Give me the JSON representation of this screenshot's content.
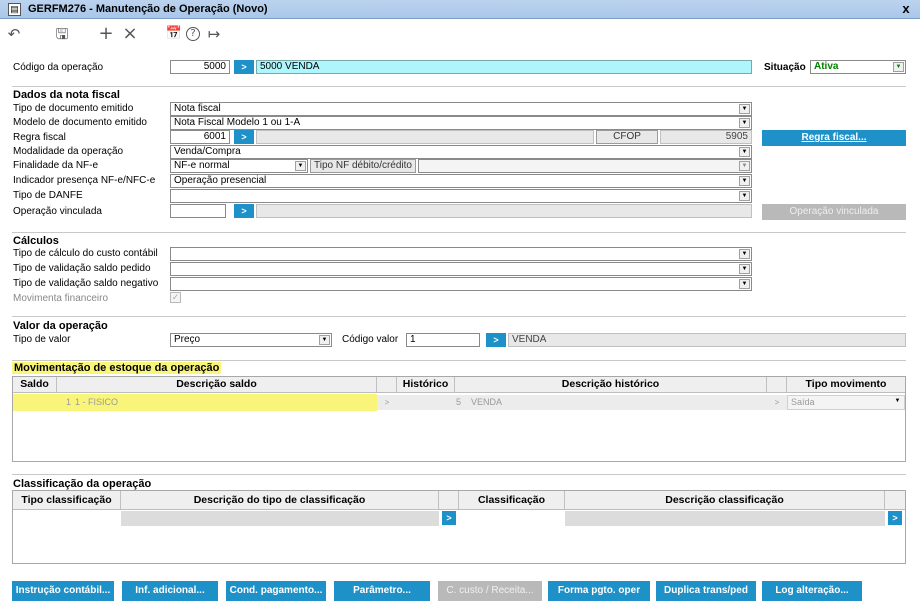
{
  "window": {
    "title": "GERFM276 - Manutenção de Operação (Novo)",
    "close_glyph": "x"
  },
  "toolbar": {
    "undo_glyph": "↶",
    "save_glyph": "🖫",
    "add_glyph": "+",
    "delete_glyph": "×",
    "calendar_glyph": "📅",
    "help_glyph": "?",
    "exit_glyph": "↦"
  },
  "header": {
    "codigo_label": "Código da operação",
    "codigo_value": "5000",
    "codigo_desc": "5000 VENDA",
    "situacao_label": "Situação",
    "situacao_value": "Ativa"
  },
  "nota_fiscal": {
    "section": "Dados da nota fiscal",
    "tipo_doc_label": "Tipo de documento emitido",
    "tipo_doc_value": "Nota fiscal",
    "modelo_label": "Modelo de documento emitido",
    "modelo_value": "Nota Fiscal Modelo 1 ou 1-A",
    "regra_label": "Regra fiscal",
    "regra_value": "6001",
    "cfop_label": "CFOP",
    "cfop_value": "5905",
    "regra_button": "Regra fiscal...",
    "modalidade_label": "Modalidade da operação",
    "modalidade_value": "Venda/Compra",
    "finalidade_label": "Finalidade da NF-e",
    "finalidade_value": "NF-e normal",
    "tipo_nf_button": "Tipo NF débito/crédito",
    "indicador_label": "Indicador presença NF-e/NFC-e",
    "indicador_value": "Operação presencial",
    "danfe_label": "Tipo de DANFE",
    "danfe_value": "",
    "vinculada_label": "Operação vinculada",
    "vinculada_value": "",
    "vinculada_button": "Operação vinculada"
  },
  "calculos": {
    "section": "Cálculos",
    "custo_label": "Tipo de cálculo do custo contábil",
    "pedido_label": "Tipo de validação saldo pedido",
    "negativo_label": "Tipo de validação saldo negativo",
    "financeiro_label": "Movimenta financeiro",
    "financeiro_checked": true
  },
  "valor": {
    "section": "Valor da operação",
    "tipo_label": "Tipo de valor",
    "tipo_value": "Preço",
    "codigo_label": "Código valor",
    "codigo_value": "1",
    "codigo_desc": "VENDA"
  },
  "estoque": {
    "section": "Movimentação de estoque da operação",
    "headers": [
      "Saldo",
      "Descrição saldo",
      "Histórico",
      "Descrição histórico",
      "Tipo movimento"
    ],
    "rows": [
      {
        "saldo": "1",
        "descricao": "1 - FISICO",
        "historico": "5",
        "desc_historico": "VENDA",
        "tipo": "Saída"
      }
    ]
  },
  "classificacao": {
    "section": "Classificação da operação",
    "headers": [
      "Tipo classificação",
      "Descrição do tipo de classificação",
      "Classificação",
      "Descrição classificação"
    ]
  },
  "buttons": {
    "instrucao": "Instrução contábil...",
    "inf": "Inf. adicional...",
    "cond": "Cond. pagamento...",
    "parametro": "Parâmetro...",
    "custo": "C. custo / Receita...",
    "forma": "Forma pgto. oper",
    "duplica": "Duplica trans/ped",
    "log": "Log alteração..."
  },
  "colors": {
    "accent": "#1d91c8",
    "highlight": "#f9f57a",
    "cyan_field": "#aef6fb",
    "status_green": "#008000"
  },
  "icons": [
    "undo-icon",
    "save-icon",
    "add-icon",
    "delete-icon",
    "calendar-icon",
    "help-icon",
    "exit-icon",
    "close-icon",
    "chevron-down-icon",
    "arrow-right-icon"
  ]
}
